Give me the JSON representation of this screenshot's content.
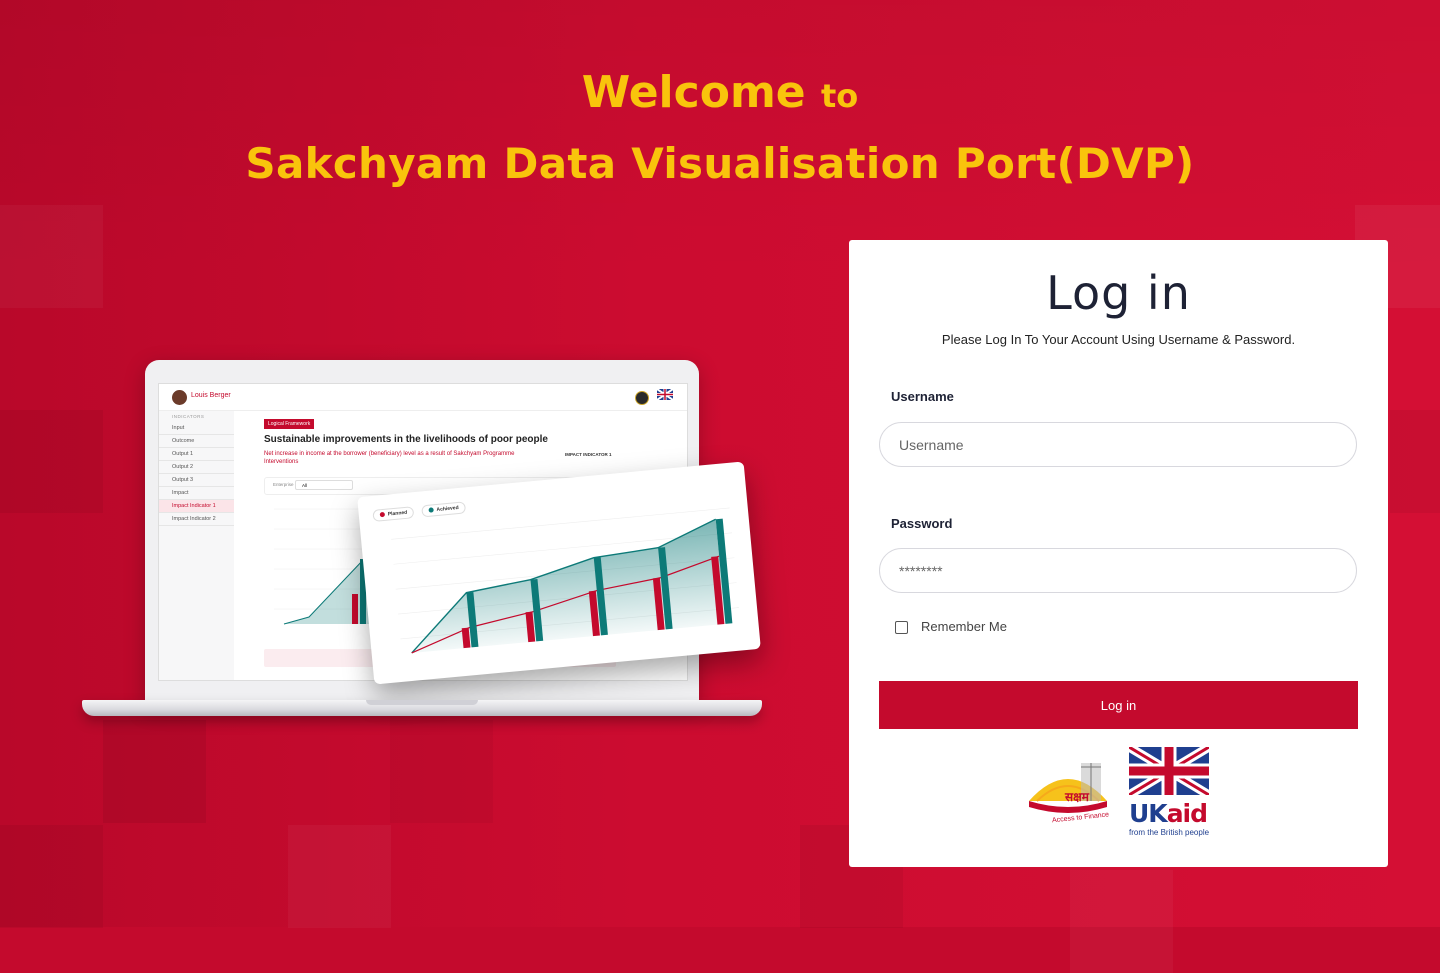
{
  "hero": {
    "welcome": "Welcome",
    "to": "to",
    "portal_name": "Sakchyam Data Visualisation Port(DVP)"
  },
  "mockup": {
    "brand": "Louis Berger",
    "sidebar": [
      {
        "label": "INDICATORS",
        "kind": "header"
      },
      {
        "label": "Input",
        "kind": "item"
      },
      {
        "label": "Outcome",
        "kind": "item"
      },
      {
        "label": "Output 1",
        "kind": "item"
      },
      {
        "label": "Output 2",
        "kind": "item"
      },
      {
        "label": "Output 3",
        "kind": "item"
      },
      {
        "label": "Impact",
        "kind": "item"
      },
      {
        "label": "Impact Indicator 1",
        "kind": "active"
      },
      {
        "label": "Impact Indicator 2",
        "kind": "item"
      }
    ],
    "tag": "Logical Framework",
    "title": "Sustainable improvements in the livelihoods of poor people",
    "subtitle": "Net increase in income at the borrower (beneficiary) level as a result of Sakchyam Programme Interventions",
    "indicator": "IMPACT INDICATOR 1",
    "filter_label": "Enterprise",
    "filter_value": "All",
    "legend_planned": "Planned",
    "legend_achieved": "Achieved"
  },
  "login": {
    "title": "Log in",
    "subtitle": "Please Log In To Your Account Using Username & Password.",
    "username_label": "Username",
    "username_placeholder": "Username",
    "password_label": "Password",
    "password_placeholder": "********",
    "remember_label": "Remember Me",
    "button_label": "Log in"
  },
  "logos": {
    "sakchyam_script": "सक्षम",
    "sakchyam_tagline": "Access to Finance",
    "ukaid_uk": "UK",
    "ukaid_aid": "aid",
    "ukaid_tagline": "from the British people"
  },
  "colors": {
    "brand_red": "#c40a2d",
    "title_yellow": "#f9c40c",
    "teal": "#0d7a78"
  }
}
